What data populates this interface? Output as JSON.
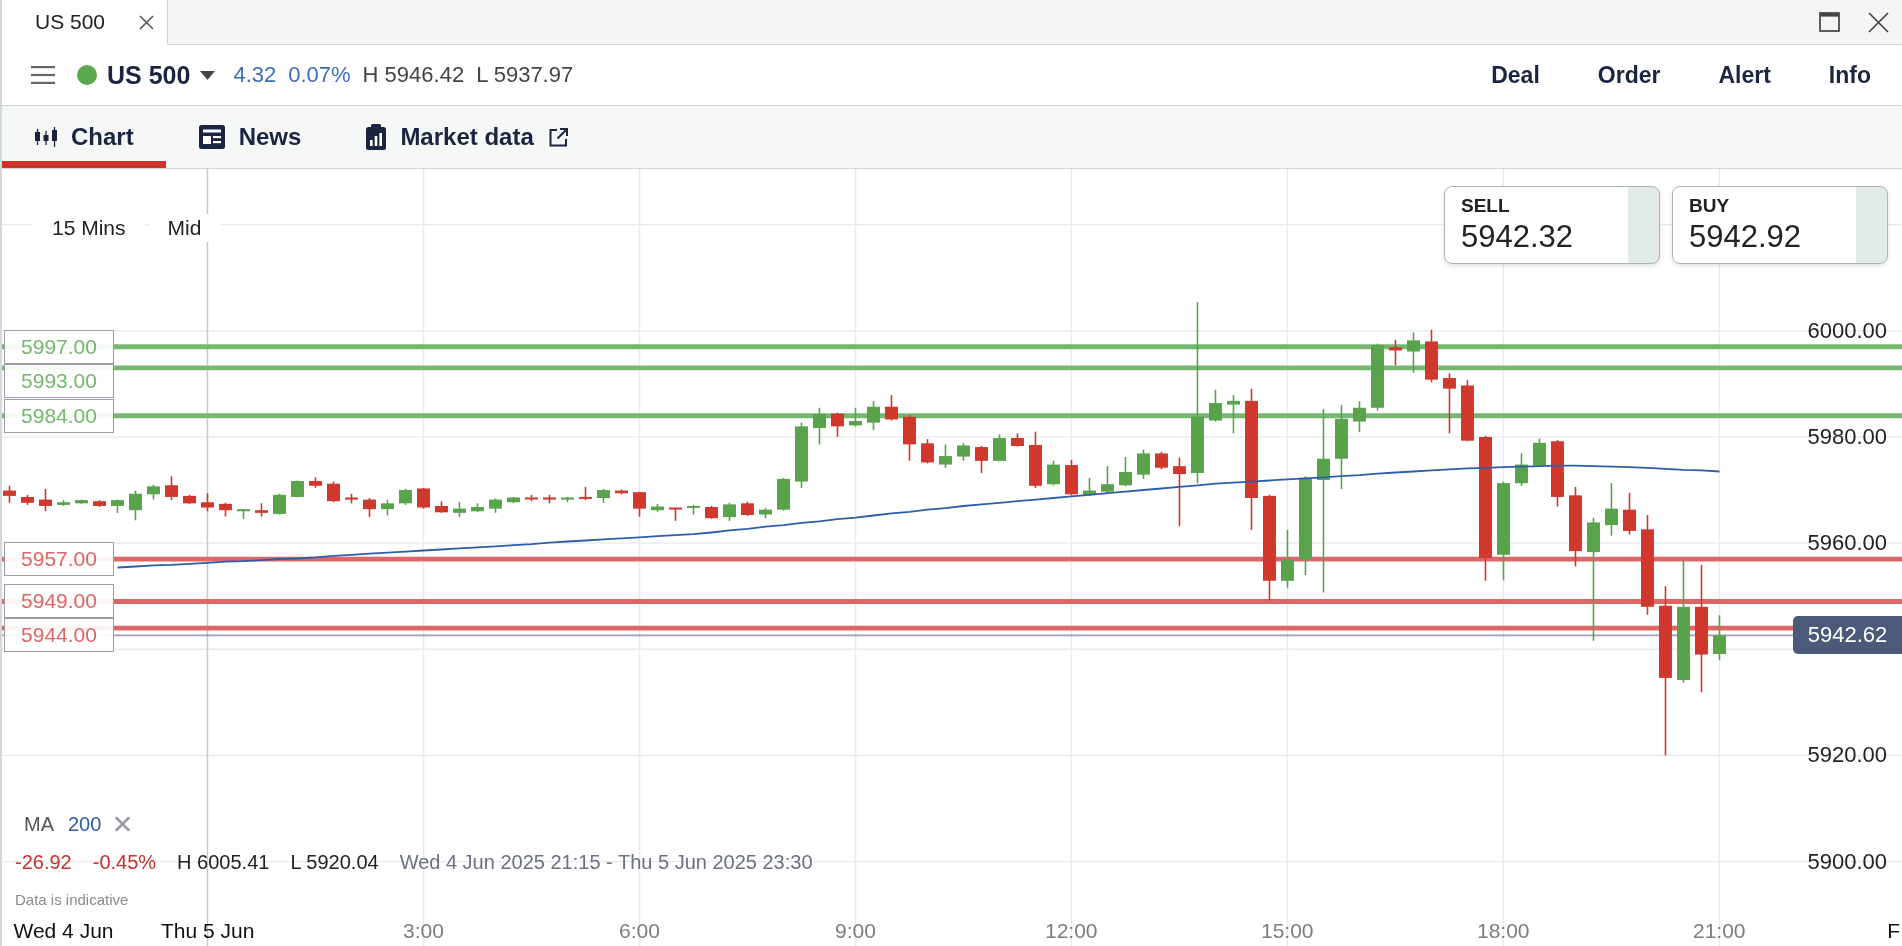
{
  "window": {
    "tab": {
      "title": "US 500",
      "selected": true
    }
  },
  "instrument": {
    "name": "US 500",
    "market_open": true,
    "change": "4.32",
    "change_percent": "0.07%",
    "high": "H 5946.42",
    "low": "L 5937.97"
  },
  "actions": [
    "Deal",
    "Order",
    "Alert",
    "Info"
  ],
  "tabs": [
    {
      "label": "Chart",
      "selected": true,
      "external": false
    },
    {
      "label": "News",
      "selected": false,
      "external": false
    },
    {
      "label": "Market data",
      "selected": false,
      "external": true
    }
  ],
  "chart": {
    "interval": "15 Mins",
    "price_type": "Mid",
    "sell": {
      "label": "SELL",
      "price": "5942.32"
    },
    "buy": {
      "label": "BUY",
      "price": "5942.92"
    },
    "indicator": {
      "name": "MA",
      "period": "200"
    },
    "summary": {
      "change": "-26.92",
      "change_percent": "-0.45%",
      "high": "H 6005.41",
      "low": "L 5920.04",
      "range": "Wed 4 Jun 2025 21:15 - Thu 5 Jun 2025 23:30"
    },
    "note": "Data is indicative",
    "chart_data": {
      "type": "candlestick",
      "x": [
        -2.75,
        -2.5,
        -2.25,
        -2,
        -1.75,
        -1.5,
        -1.25,
        -1,
        -0.75,
        -0.5,
        -0.25,
        0,
        0.25,
        0.5,
        0.75,
        1,
        1.25,
        1.5,
        1.75,
        2,
        2.25,
        2.5,
        2.75,
        3,
        3.25,
        3.5,
        3.75,
        4,
        4.25,
        4.5,
        4.75,
        5,
        5.25,
        5.5,
        5.75,
        6,
        6.25,
        6.5,
        6.75,
        7,
        7.25,
        7.5,
        7.75,
        8,
        8.25,
        8.5,
        8.75,
        9,
        9.25,
        9.5,
        9.75,
        10,
        10.25,
        10.5,
        10.75,
        11,
        11.25,
        11.5,
        11.75,
        12,
        12.25,
        12.5,
        12.75,
        13,
        13.25,
        13.5,
        13.75,
        14,
        14.25,
        14.5,
        14.75,
        15,
        15.25,
        15.5,
        15.75,
        16,
        16.25,
        16.5,
        16.75,
        17,
        17.25,
        17.5,
        17.75,
        18,
        18.25,
        18.5,
        18.75,
        19,
        19.25,
        19.5,
        19.75,
        20,
        20.25,
        20.5,
        20.75,
        21
      ],
      "ohlc": [
        [
          5969.9,
          5970.8,
          5967.6,
          5968.9
        ],
        [
          5968.7,
          5969.1,
          5967.2,
          5967.6
        ],
        [
          5968.2,
          5970.2,
          5966.0,
          5967.0
        ],
        [
          5967.2,
          5968.1,
          5967.0,
          5967.7
        ],
        [
          5967.5,
          5968.2,
          5967.4,
          5968.1
        ],
        [
          5967.9,
          5968.1,
          5966.8,
          5967.0
        ],
        [
          5967.0,
          5968.2,
          5965.7,
          5968.1
        ],
        [
          5966.2,
          5969.9,
          5964.3,
          5969.3
        ],
        [
          5969.2,
          5971.0,
          5968.2,
          5970.7
        ],
        [
          5970.9,
          5972.6,
          5968.1,
          5968.7
        ],
        [
          5968.9,
          5969.1,
          5967.4,
          5967.5
        ],
        [
          5967.7,
          5969.4,
          5966.0,
          5966.7
        ],
        [
          5967.4,
          5967.6,
          5965.0,
          5966.2
        ],
        [
          5966.0,
          5966.4,
          5964.5,
          5966.4
        ],
        [
          5966.2,
          5967.5,
          5965.0,
          5965.7
        ],
        [
          5965.5,
          5969.3,
          5965.4,
          5969.1
        ],
        [
          5968.7,
          5971.8,
          5968.6,
          5971.7
        ],
        [
          5971.7,
          5972.4,
          5970.4,
          5970.8
        ],
        [
          5971.2,
          5971.6,
          5967.7,
          5967.9
        ],
        [
          5968.6,
          5969.3,
          5967.5,
          5968.2
        ],
        [
          5968.2,
          5968.5,
          5964.9,
          5966.4
        ],
        [
          5966.4,
          5968.2,
          5965.2,
          5967.5
        ],
        [
          5967.5,
          5970.2,
          5967.2,
          5970.0
        ],
        [
          5970.3,
          5970.4,
          5966.5,
          5966.7
        ],
        [
          5967.0,
          5967.9,
          5965.7,
          5965.8
        ],
        [
          5965.7,
          5967.7,
          5964.9,
          5966.5
        ],
        [
          5966.0,
          5967.5,
          5965.9,
          5966.8
        ],
        [
          5966.5,
          5968.4,
          5965.7,
          5968.2
        ],
        [
          5967.7,
          5968.7,
          5967.5,
          5968.6
        ],
        [
          5968.6,
          5969.1,
          5967.9,
          5968.3
        ],
        [
          5968.6,
          5969.1,
          5967.5,
          5968.2
        ],
        [
          5968.2,
          5968.7,
          5967.7,
          5968.6
        ],
        [
          5968.7,
          5970.6,
          5968.1,
          5968.4
        ],
        [
          5968.5,
          5970.2,
          5967.6,
          5970.0
        ],
        [
          5969.9,
          5970.1,
          5969.2,
          5969.4
        ],
        [
          5969.6,
          5969.7,
          5965.0,
          5966.5
        ],
        [
          5966.2,
          5967.4,
          5965.9,
          5966.9
        ],
        [
          5966.7,
          5966.7,
          5964.2,
          5966.5
        ],
        [
          5966.7,
          5967.2,
          5965.4,
          5967.0
        ],
        [
          5966.8,
          5967.0,
          5964.6,
          5964.7
        ],
        [
          5964.9,
          5967.6,
          5964.2,
          5967.3
        ],
        [
          5967.5,
          5967.8,
          5965.1,
          5965.3
        ],
        [
          5965.4,
          5966.6,
          5964.7,
          5966.3
        ],
        [
          5966.3,
          5972.3,
          5966.1,
          5972.1
        ],
        [
          5971.6,
          5982.7,
          5970.4,
          5982.0
        ],
        [
          5981.7,
          5985.5,
          5978.6,
          5984.3
        ],
        [
          5984.4,
          5984.6,
          5980.0,
          5982.0
        ],
        [
          5982.2,
          5985.5,
          5982.0,
          5983.0
        ],
        [
          5982.7,
          5986.8,
          5981.3,
          5985.7
        ],
        [
          5985.7,
          5987.9,
          5983.1,
          5983.3
        ],
        [
          5983.8,
          5984.1,
          5975.5,
          5978.6
        ],
        [
          5978.8,
          5979.6,
          5975.0,
          5975.2
        ],
        [
          5974.8,
          5978.6,
          5974.2,
          5976.4
        ],
        [
          5976.3,
          5978.8,
          5975.5,
          5978.4
        ],
        [
          5978.1,
          5978.3,
          5973.2,
          5975.5
        ],
        [
          5975.5,
          5980.5,
          5975.4,
          5979.8
        ],
        [
          5979.8,
          5980.7,
          5978.2,
          5978.3
        ],
        [
          5978.5,
          5981.0,
          5970.4,
          5970.8
        ],
        [
          5971.1,
          5975.5,
          5970.9,
          5974.8
        ],
        [
          5974.7,
          5975.7,
          5969.0,
          5969.2
        ],
        [
          5969.1,
          5972.3,
          5968.9,
          5969.9
        ],
        [
          5969.7,
          5974.5,
          5969.4,
          5971.1
        ],
        [
          5970.9,
          5976.2,
          5970.7,
          5973.4
        ],
        [
          5972.9,
          5977.6,
          5972.1,
          5976.9
        ],
        [
          5976.9,
          5977.2,
          5973.9,
          5974.2
        ],
        [
          5974.5,
          5976.1,
          5963.2,
          5973.0
        ],
        [
          5973.2,
          6005.4,
          5971.3,
          5983.8
        ],
        [
          5983.1,
          5988.9,
          5982.9,
          5986.4
        ],
        [
          5986.1,
          5987.9,
          5980.7,
          5986.8
        ],
        [
          5986.8,
          5989.1,
          5962.5,
          5968.5
        ],
        [
          5968.9,
          5969.1,
          5949.2,
          5952.9
        ],
        [
          5952.9,
          5962.5,
          5951.6,
          5956.9
        ],
        [
          5956.9,
          5972.6,
          5954.0,
          5972.3
        ],
        [
          5971.9,
          5985.3,
          5950.7,
          5975.9
        ],
        [
          5975.9,
          5986.0,
          5970.2,
          5983.4
        ],
        [
          5982.9,
          5986.7,
          5980.9,
          5985.5
        ],
        [
          5985.5,
          5997.6,
          5985.0,
          5997.3
        ],
        [
          5996.9,
          5998.3,
          5993.5,
          5996.3
        ],
        [
          5996.1,
          5999.7,
          5992.1,
          5998.2
        ],
        [
          5998.0,
          6000.2,
          5990.3,
          5990.8
        ],
        [
          5991.1,
          5992.0,
          5980.7,
          5989.1
        ],
        [
          5989.7,
          5990.7,
          5979.2,
          5979.3
        ],
        [
          5980.0,
          5980.2,
          5952.9,
          5957.2
        ],
        [
          5957.8,
          5971.6,
          5953.0,
          5971.3
        ],
        [
          5971.3,
          5976.9,
          5970.8,
          5974.8
        ],
        [
          5974.6,
          5979.7,
          5974.5,
          5978.9
        ],
        [
          5979.2,
          5979.4,
          5966.9,
          5968.7
        ],
        [
          5969.0,
          5970.6,
          5955.6,
          5958.5
        ],
        [
          5958.3,
          5964.8,
          5941.6,
          5963.9
        ],
        [
          5963.4,
          5971.3,
          5961.4,
          5966.5
        ],
        [
          5966.3,
          5969.5,
          5961.6,
          5962.3
        ],
        [
          5962.6,
          5965.3,
          5946.5,
          5948.0
        ],
        [
          5948.2,
          5951.9,
          5920.0,
          5934.6
        ],
        [
          5934.2,
          5956.9,
          5933.7,
          5948.0
        ],
        [
          5948.0,
          5955.9,
          5931.9,
          5939.0
        ],
        [
          5939.1,
          5946.4,
          5938.0,
          5942.62
        ]
      ],
      "series": [
        {
          "type": "line",
          "color": "#2f5ea8",
          "values": [
            null,
            null,
            null,
            null,
            null,
            null,
            5955.4,
            5955.6,
            5955.8,
            5955.9,
            5956.1,
            5956.3,
            5956.5,
            5956.6,
            5956.8,
            5957.0,
            5957.1,
            5957.3,
            5957.6,
            5957.8,
            5958.0,
            5958.2,
            5958.4,
            5958.6,
            5958.8,
            5959.0,
            5959.2,
            5959.4,
            5959.6,
            5959.8,
            5960.1,
            5960.3,
            5960.5,
            5960.7,
            5960.9,
            5961.1,
            5961.3,
            5961.5,
            5961.7,
            5962.0,
            5962.4,
            5962.7,
            5963.1,
            5963.4,
            5963.8,
            5964.1,
            5964.5,
            5964.8,
            5965.2,
            5965.6,
            5965.9,
            5966.3,
            5966.6,
            5967.0,
            5967.3,
            5967.6,
            5967.9,
            5968.2,
            5968.5,
            5968.8,
            5969.1,
            5969.4,
            5969.7,
            5970.0,
            5970.3,
            5970.6,
            5970.9,
            5971.2,
            5971.4,
            5971.6,
            5971.8,
            5972.0,
            5972.2,
            5972.4,
            5972.6,
            5972.8,
            5973.1,
            5973.3,
            5973.5,
            5973.7,
            5973.9,
            5974.1,
            5974.2,
            5974.3,
            5974.4,
            5974.5,
            5974.6,
            5974.6,
            5974.5,
            5974.4,
            5974.3,
            5974.2,
            5974.0,
            5973.8,
            5973.7,
            5973.5
          ]
        }
      ],
      "xlim": [
        -2.854,
        23.535
      ],
      "ylim": [
        5884.09,
        6030.49
      ],
      "grid": true,
      "xticks": [
        {
          "value": -2,
          "label": "Wed 4 Jun"
        },
        {
          "value": 0,
          "label": "Thu 5 Jun"
        },
        {
          "value": 3,
          "label": "3:00"
        },
        {
          "value": 6,
          "label": "6:00"
        },
        {
          "value": 9,
          "label": "9:00"
        },
        {
          "value": 12,
          "label": "12:00"
        },
        {
          "value": 15,
          "label": "15:00"
        },
        {
          "value": 18,
          "label": "18:00"
        },
        {
          "value": 21,
          "label": "21:00"
        },
        {
          "value": 23.42,
          "label": "F"
        }
      ],
      "yticks": [
        {
          "value": 6000,
          "label": "6000.00"
        },
        {
          "value": 5980,
          "label": "5980.00"
        },
        {
          "value": 5960,
          "label": "5960.00"
        },
        {
          "value": 5920,
          "label": "5920.00"
        },
        {
          "value": 5900,
          "label": "5900.00"
        }
      ],
      "ref_lines": [
        {
          "axis": "y",
          "value": 5997,
          "label": "5997.00",
          "color": "#76b86f"
        },
        {
          "axis": "y",
          "value": 5993,
          "label": "5993.00",
          "color": "#76b86f"
        },
        {
          "axis": "y",
          "value": 5984,
          "label": "5984.00",
          "color": "#76b86f"
        },
        {
          "axis": "y",
          "value": 5957,
          "label": "5957.00",
          "color": "#dd6666"
        },
        {
          "axis": "y",
          "value": 5949,
          "label": "5949.00",
          "color": "#dd6666"
        },
        {
          "axis": "y",
          "value": 5944,
          "label": "5944.00",
          "color": "#dd6666"
        },
        {
          "axis": "y",
          "value": 5942.62,
          "label": "5942.62",
          "color": "#4b5a78"
        }
      ]
    }
  }
}
